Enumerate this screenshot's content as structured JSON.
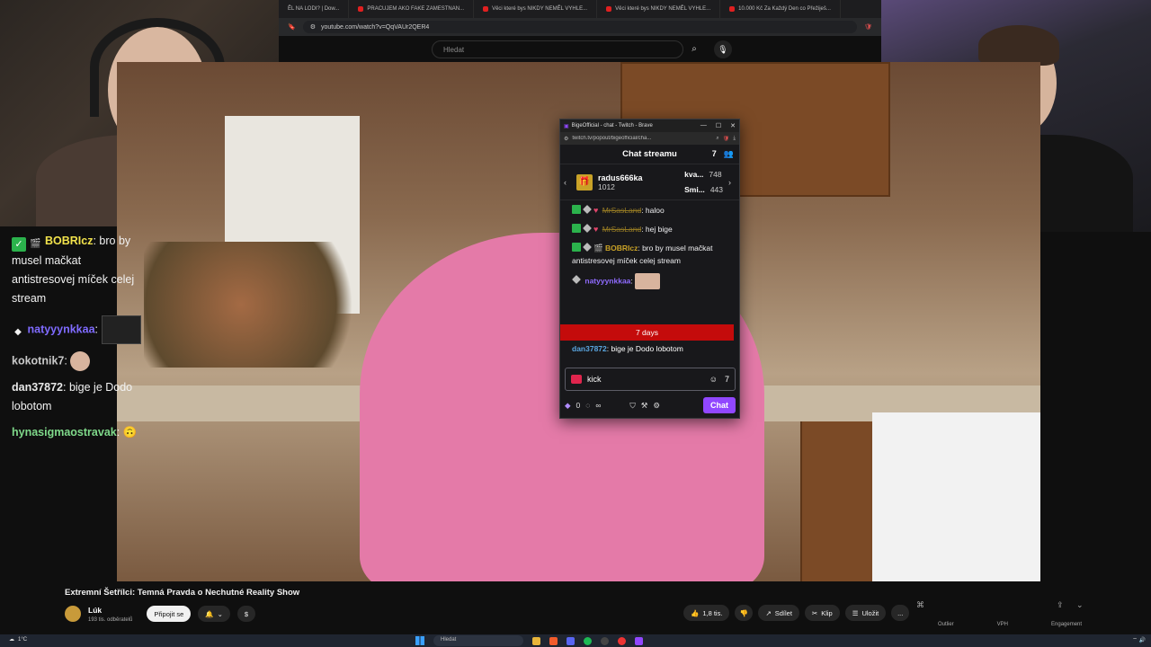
{
  "browser": {
    "tabs": [
      {
        "label": "ĚL NA LODI? | Dow..."
      },
      {
        "label": "PRACUJEM AKO FAKE ZAMESTNAN..."
      },
      {
        "label": "Věci které bys NIKDY NEMĚL VYHLE..."
      },
      {
        "label": "Věci které bys NIKDY NEMĚL VYHLE..."
      },
      {
        "label": "10.000 Kč Za Každý Den co Přežiješ..."
      }
    ],
    "url": "youtube.com/watch?v=QqVAUr2QER4",
    "search_placeholder": "Hledat"
  },
  "left_chat": [
    {
      "user": "BOBRIcz",
      "user_color": "#f1e24c",
      "text": "bro by musel mačkat antistresovej míček celej stream",
      "badges": [
        "checkmark",
        "clapper"
      ]
    },
    {
      "user": "natyyynkkaa",
      "user_color": "#7f6bff",
      "text": "",
      "has_image": true
    },
    {
      "user": "kokotnik7",
      "user_color": "#c9c9c9",
      "text": "",
      "has_face": true
    },
    {
      "user": "dan37872",
      "user_color": "#8fd3f5",
      "text": "bige je Dodo lobotom"
    },
    {
      "user": "hynasigmaostravak",
      "user_color": "#7fd98a",
      "text": "",
      "emote": "🙃"
    }
  ],
  "popout": {
    "window_title": "BigeOfficial - chat - Twitch - Brave",
    "url": "twitch.tv/popout/bigeofficial/cha...",
    "header": "Chat streamu",
    "leaderboard": {
      "top_user": "radus666ka",
      "top_count": "1012",
      "side": [
        {
          "name": "kva...",
          "count": "748"
        },
        {
          "name": "Smi...",
          "count": "443"
        }
      ]
    },
    "messages": [
      {
        "user": "MrSasLand",
        "text": "haloo",
        "struck": true
      },
      {
        "user": "MrSasLand",
        "text": "hej bige",
        "struck": true
      },
      {
        "user": "BOBRIcz",
        "user_color": "#c9a227",
        "text": "bro by musel mačkat antistresovej míček celej stream"
      },
      {
        "user": "natyyynkkaa",
        "user_color": "#8f6bff",
        "text": ""
      },
      {
        "user": "dan37872",
        "user_color": "#5aa6e0",
        "text": "bige je Dodo lobotom"
      }
    ],
    "timeout_label": "7 days",
    "input_value": "kick",
    "points": "0",
    "infinity": "∞",
    "chat_button": "Chat"
  },
  "video": {
    "title": "Extremní Šetřílci: Temná Pravda o Nechutné Reality Show",
    "channel_name": "Lúk",
    "subscribers": "193 tis. odběratelů",
    "join_label": "Připojit se",
    "likes": "1,8 tis.",
    "share": "Sdílet",
    "clip": "Klip",
    "save": "Uložit",
    "more": "...",
    "dollar": "$"
  },
  "right_panel": {
    "labels": [
      "Outlier",
      "VPH",
      "Engagement"
    ]
  },
  "taskbar": {
    "weather": "1°C",
    "search": "Hledat"
  },
  "colors": {
    "twitch_purple": "#9147ff",
    "timeout_red": "#c40b0b",
    "chat_bg": "#18181b"
  }
}
